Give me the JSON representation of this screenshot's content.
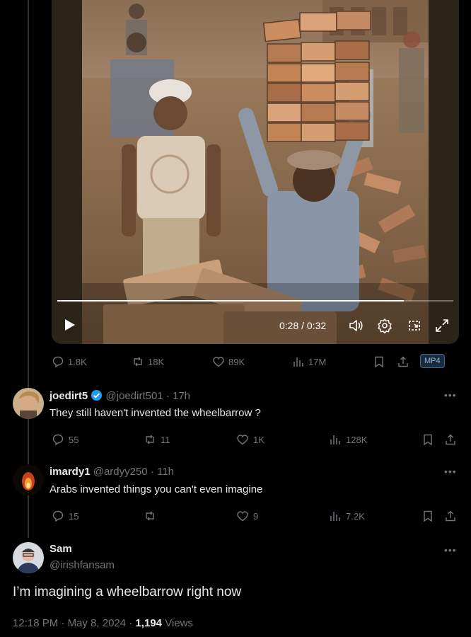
{
  "video": {
    "time_label": "0:28 / 0:32",
    "progress": 0.875
  },
  "post_stats": {
    "replies": "1.8K",
    "reposts": "18K",
    "likes": "89K",
    "views": "17M",
    "download_badge": "MP4"
  },
  "replies": [
    {
      "name": "joedirt5",
      "handle": "@joedirt501",
      "time": "17h",
      "verified": true,
      "text": "They still haven't invented the wheelbarrow ?",
      "replies": "55",
      "reposts": "11",
      "likes": "1K",
      "views": "128K"
    },
    {
      "name": "imardy1",
      "handle": "@ardyy250",
      "time": "11h",
      "verified": false,
      "text": "Arabs invented things you can't even imagine",
      "replies": "15",
      "reposts": "",
      "likes": "9",
      "views": "7.2K"
    }
  ],
  "main_reply": {
    "name": "Sam",
    "handle": "@irishfansam",
    "text": "I’m imagining a wheelbarrow right now",
    "time": "12:18 PM",
    "date": "May 8, 2024",
    "views_count": "1,194",
    "views_label": "Views"
  },
  "colors": {
    "background": "#000000",
    "text": "#e7e9ea",
    "muted": "#71767b",
    "verified": "#1d9bf0"
  }
}
